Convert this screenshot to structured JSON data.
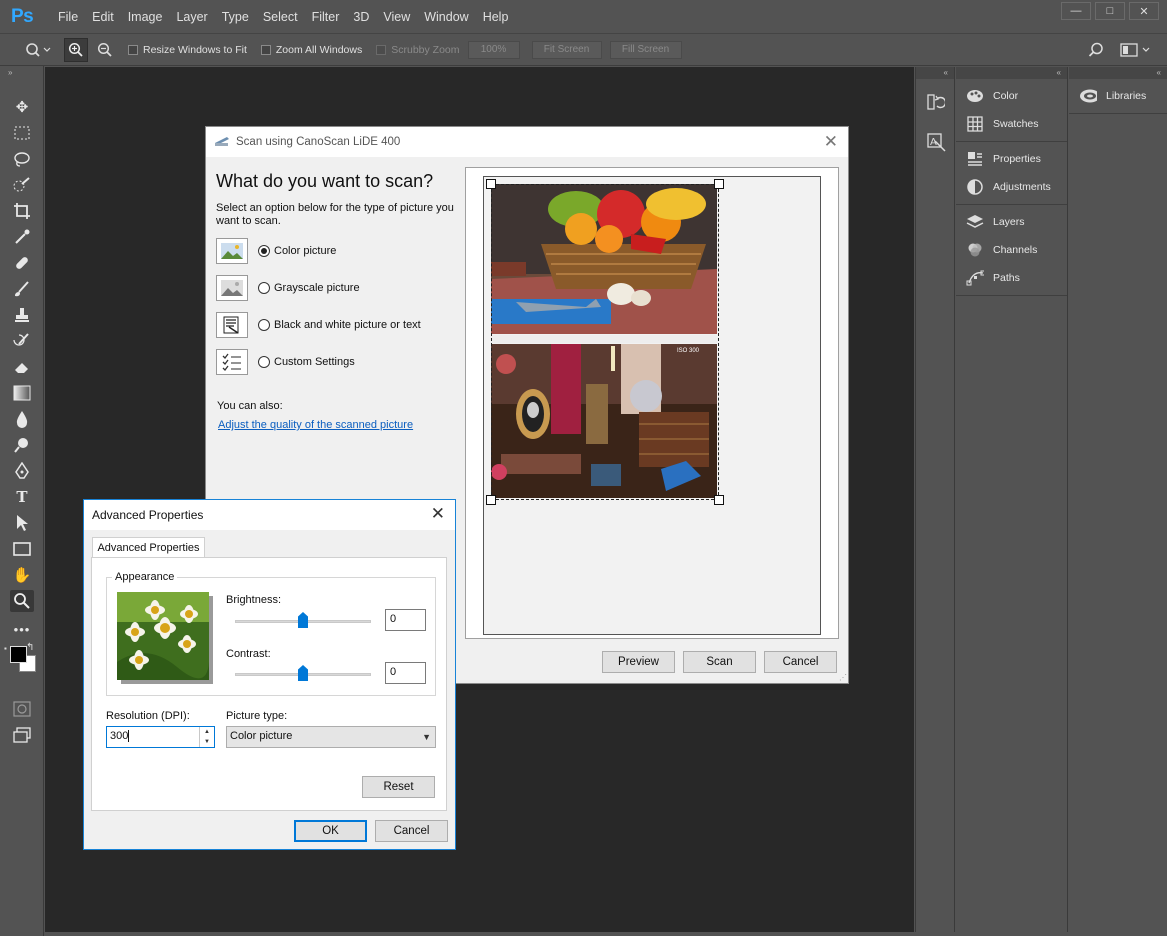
{
  "app": {
    "logo": "Ps",
    "menu": [
      "File",
      "Edit",
      "Image",
      "Layer",
      "Type",
      "Select",
      "Filter",
      "3D",
      "View",
      "Window",
      "Help"
    ],
    "window_controls": [
      "—",
      "□",
      "✕"
    ]
  },
  "options_bar": {
    "resize_windows": "Resize Windows to Fit",
    "zoom_all": "Zoom All Windows",
    "scrubby_zoom": "Scrubby Zoom",
    "zoom_100": "100%",
    "fit_screen": "Fit Screen",
    "fill_screen": "Fill Screen"
  },
  "panels": {
    "col1": [
      {
        "label": "Color",
        "icon": "color-palette-icon"
      },
      {
        "label": "Swatches",
        "icon": "swatches-grid-icon"
      },
      {
        "label": "Properties",
        "icon": "properties-icon"
      },
      {
        "label": "Adjustments",
        "icon": "adjustments-icon"
      },
      {
        "label": "Layers",
        "icon": "layers-icon"
      },
      {
        "label": "Channels",
        "icon": "channels-icon"
      },
      {
        "label": "Paths",
        "icon": "paths-icon"
      }
    ],
    "col2": [
      {
        "label": "Libraries",
        "icon": "cloud-libraries-icon"
      }
    ]
  },
  "scan_dialog": {
    "title": "Scan using CanoScan LiDE 400",
    "heading": "What do you want to scan?",
    "description": "Select an option below for the type of picture you want to scan.",
    "options": [
      {
        "label": "Color picture",
        "selected": true
      },
      {
        "label": "Grayscale picture",
        "selected": false
      },
      {
        "label": "Black and white picture or text",
        "selected": false
      },
      {
        "label": "Custom Settings",
        "selected": false
      }
    ],
    "also_label": "You can also:",
    "adjust_link": "Adjust the quality of the scanned picture",
    "preview_button": "Preview",
    "scan_button": "Scan",
    "cancel_button": "Cancel",
    "iso_mark": "ISO 300"
  },
  "advanced_dialog": {
    "title": "Advanced Properties",
    "tab": "Advanced Properties",
    "appearance_label": "Appearance",
    "brightness_label": "Brightness:",
    "brightness_value": "0",
    "contrast_label": "Contrast:",
    "contrast_value": "0",
    "slider_level": 0.5,
    "resolution_label": "Resolution (DPI):",
    "resolution_value": "300",
    "picture_type_label": "Picture type:",
    "picture_type_value": "Color picture",
    "reset_button": "Reset",
    "ok_button": "OK",
    "cancel_button": "Cancel"
  },
  "colors": {
    "ps_blue": "#31a8ff",
    "ui_gray": "#535353",
    "canvas": "#282828",
    "win_accent": "#0078d7"
  }
}
